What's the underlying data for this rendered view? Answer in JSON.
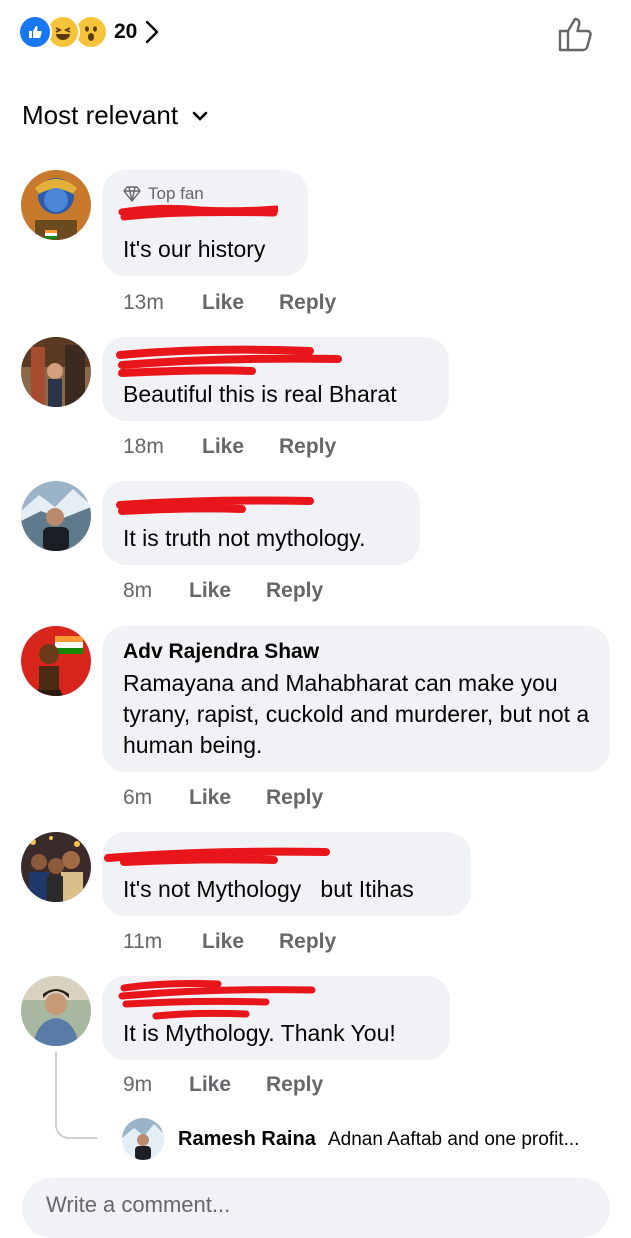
{
  "reactions": {
    "count": "20",
    "types": [
      "like-icon",
      "haha-icon",
      "wow-icon"
    ],
    "colors": {
      "like": "#1877f2",
      "emoji": "#f7c33b"
    }
  },
  "sort": {
    "label": "Most relevant"
  },
  "comments": [
    {
      "badge": "Top fan",
      "author": "",
      "text": "It's our history",
      "time": "13m",
      "like": "Like",
      "reply": "Reply"
    },
    {
      "author": "",
      "text": "Beautiful this is real Bharat",
      "time": "18m",
      "like": "Like",
      "reply": "Reply"
    },
    {
      "author": "",
      "text": "It is truth not mythology.",
      "time": "8m",
      "like": "Like",
      "reply": "Reply"
    },
    {
      "author": "Adv Rajendra Shaw",
      "text": "Ramayana and Mahabharat can make you tyrany, rapist, cuckold and murderer, but not a human being.",
      "time": "6m",
      "like": "Like",
      "reply": "Reply"
    },
    {
      "author": "",
      "text": "It's not Mythology   but Itihas",
      "time": "11m",
      "like": "Like",
      "reply": "Reply"
    },
    {
      "author": "",
      "text": "It is Mythology. Thank You!",
      "time": "9m",
      "like": "Like",
      "reply": "Reply"
    }
  ],
  "reply_preview": {
    "name": "Ramesh Raina",
    "text": "Adnan Aaftab and one profit..."
  },
  "write_placeholder": "Write a comment..."
}
